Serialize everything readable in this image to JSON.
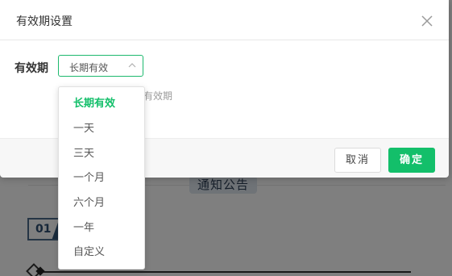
{
  "background": {
    "notice_tag": "通知公告",
    "badge_number": "01"
  },
  "dialog": {
    "title": "有效期设置",
    "field_label": "有效期",
    "select": {
      "value": "长期有效",
      "options": [
        "长期有效",
        "一天",
        "三天",
        "一个月",
        "六个月",
        "一年",
        "自定义"
      ],
      "selected_index": 0
    },
    "hint_text": "有效期",
    "buttons": {
      "cancel": "取消",
      "confirm": "确定"
    }
  },
  "colors": {
    "accent": "#13bf6a",
    "select_border": "#1db96e"
  }
}
